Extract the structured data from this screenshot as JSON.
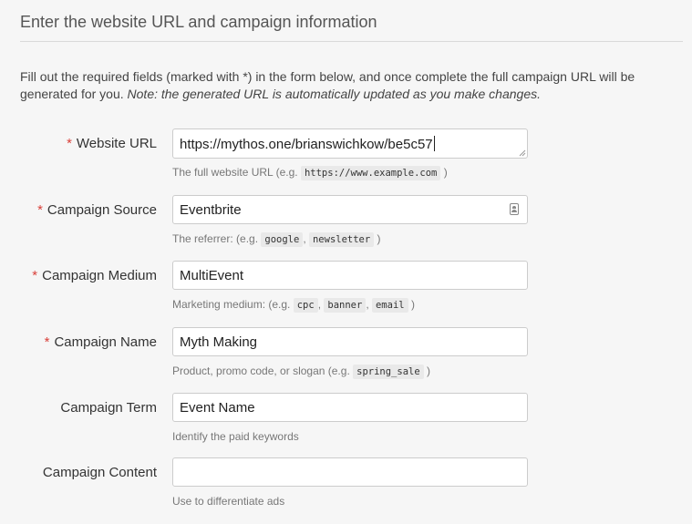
{
  "heading": "Enter the website URL and campaign information",
  "intro": {
    "text": "Fill out the required fields (marked with *) in the form below, and once complete the full campaign URL will be generated for you.",
    "note": "Note: the generated URL is automatically updated as you make changes."
  },
  "required_marker": "*",
  "fields": [
    {
      "label": "Website URL",
      "required": true,
      "value": "https://mythos.one/brianswichkow/be5c57",
      "placeholder": "",
      "help_prefix": "The full website URL (e.g.",
      "help_codes": [
        "https://www.example.com"
      ],
      "help_suffix": ")"
    },
    {
      "label": "Campaign Source",
      "required": true,
      "value": "Eventbrite",
      "placeholder": "",
      "help_prefix": "The referrer: (e.g.",
      "help_codes": [
        "google",
        "newsletter"
      ],
      "help_suffix": ")"
    },
    {
      "label": "Campaign Medium",
      "required": true,
      "value": "MultiEvent",
      "placeholder": "",
      "help_prefix": "Marketing medium: (e.g.",
      "help_codes": [
        "cpc",
        "banner",
        "email"
      ],
      "help_suffix": ")"
    },
    {
      "label": "Campaign Name",
      "required": true,
      "value": "Myth Making",
      "placeholder": "",
      "help_prefix": "Product, promo code, or slogan (e.g.",
      "help_codes": [
        "spring_sale"
      ],
      "help_suffix": ")"
    },
    {
      "label": "Campaign Term",
      "required": false,
      "value": "Event Name",
      "placeholder": "",
      "help_prefix": "Identify the paid keywords",
      "help_codes": [],
      "help_suffix": ""
    },
    {
      "label": "Campaign Content",
      "required": false,
      "value": "",
      "placeholder": "",
      "help_prefix": "Use to differentiate ads",
      "help_codes": [],
      "help_suffix": ""
    }
  ],
  "icons": {
    "url_field_resize": "resize-grip-icon",
    "source_field_autofill": "contact-card-icon"
  }
}
